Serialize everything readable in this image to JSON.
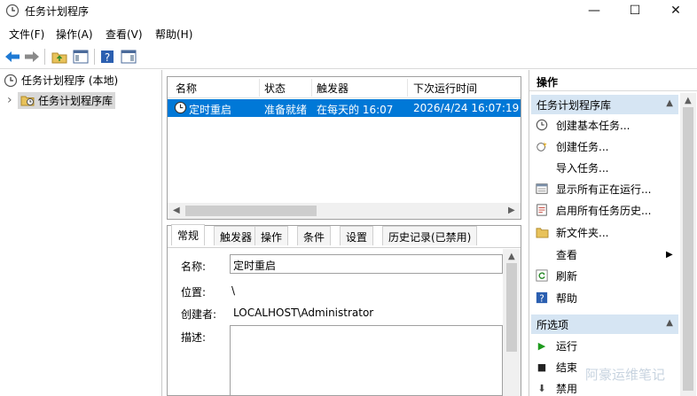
{
  "window": {
    "title": "任务计划程序",
    "min_glyph": "—",
    "max_glyph": "☐",
    "close_glyph": "✕"
  },
  "menu": [
    "文件(F)",
    "操作(A)",
    "查看(V)",
    "帮助(H)"
  ],
  "tree": {
    "root": "任务计划程序 (本地)",
    "child": "任务计划程序库",
    "expander": "›"
  },
  "list": {
    "columns": [
      "名称",
      "状态",
      "触发器",
      "下次运行时间"
    ],
    "rows": [
      {
        "name": "定时重启",
        "status": "准备就绪",
        "trigger": "在每天的 16:07",
        "next_run": "2026/4/24 16:07:19"
      }
    ]
  },
  "detail": {
    "tabs": [
      "常规",
      "触发器",
      "操作",
      "条件",
      "设置",
      "历史记录(已禁用)"
    ],
    "name_label": "名称:",
    "name_value": "定时重启",
    "location_label": "位置:",
    "location_value": "\\",
    "author_label": "创建者:",
    "author_value": "LOCALHOST\\Administrator",
    "desc_label": "描述:"
  },
  "actions": {
    "title": "操作",
    "section1": "任务计划程序库",
    "items1": [
      "创建基本任务...",
      "创建任务...",
      "导入任务...",
      "显示所有正在运行...",
      "启用所有任务历史...",
      "新文件夹...",
      "查看",
      "刷新",
      "帮助"
    ],
    "submenu_glyph": "▶",
    "section2": "所选项",
    "items2": [
      "运行",
      "结束",
      "禁用"
    ]
  },
  "watermark": "阿豪运维笔记"
}
